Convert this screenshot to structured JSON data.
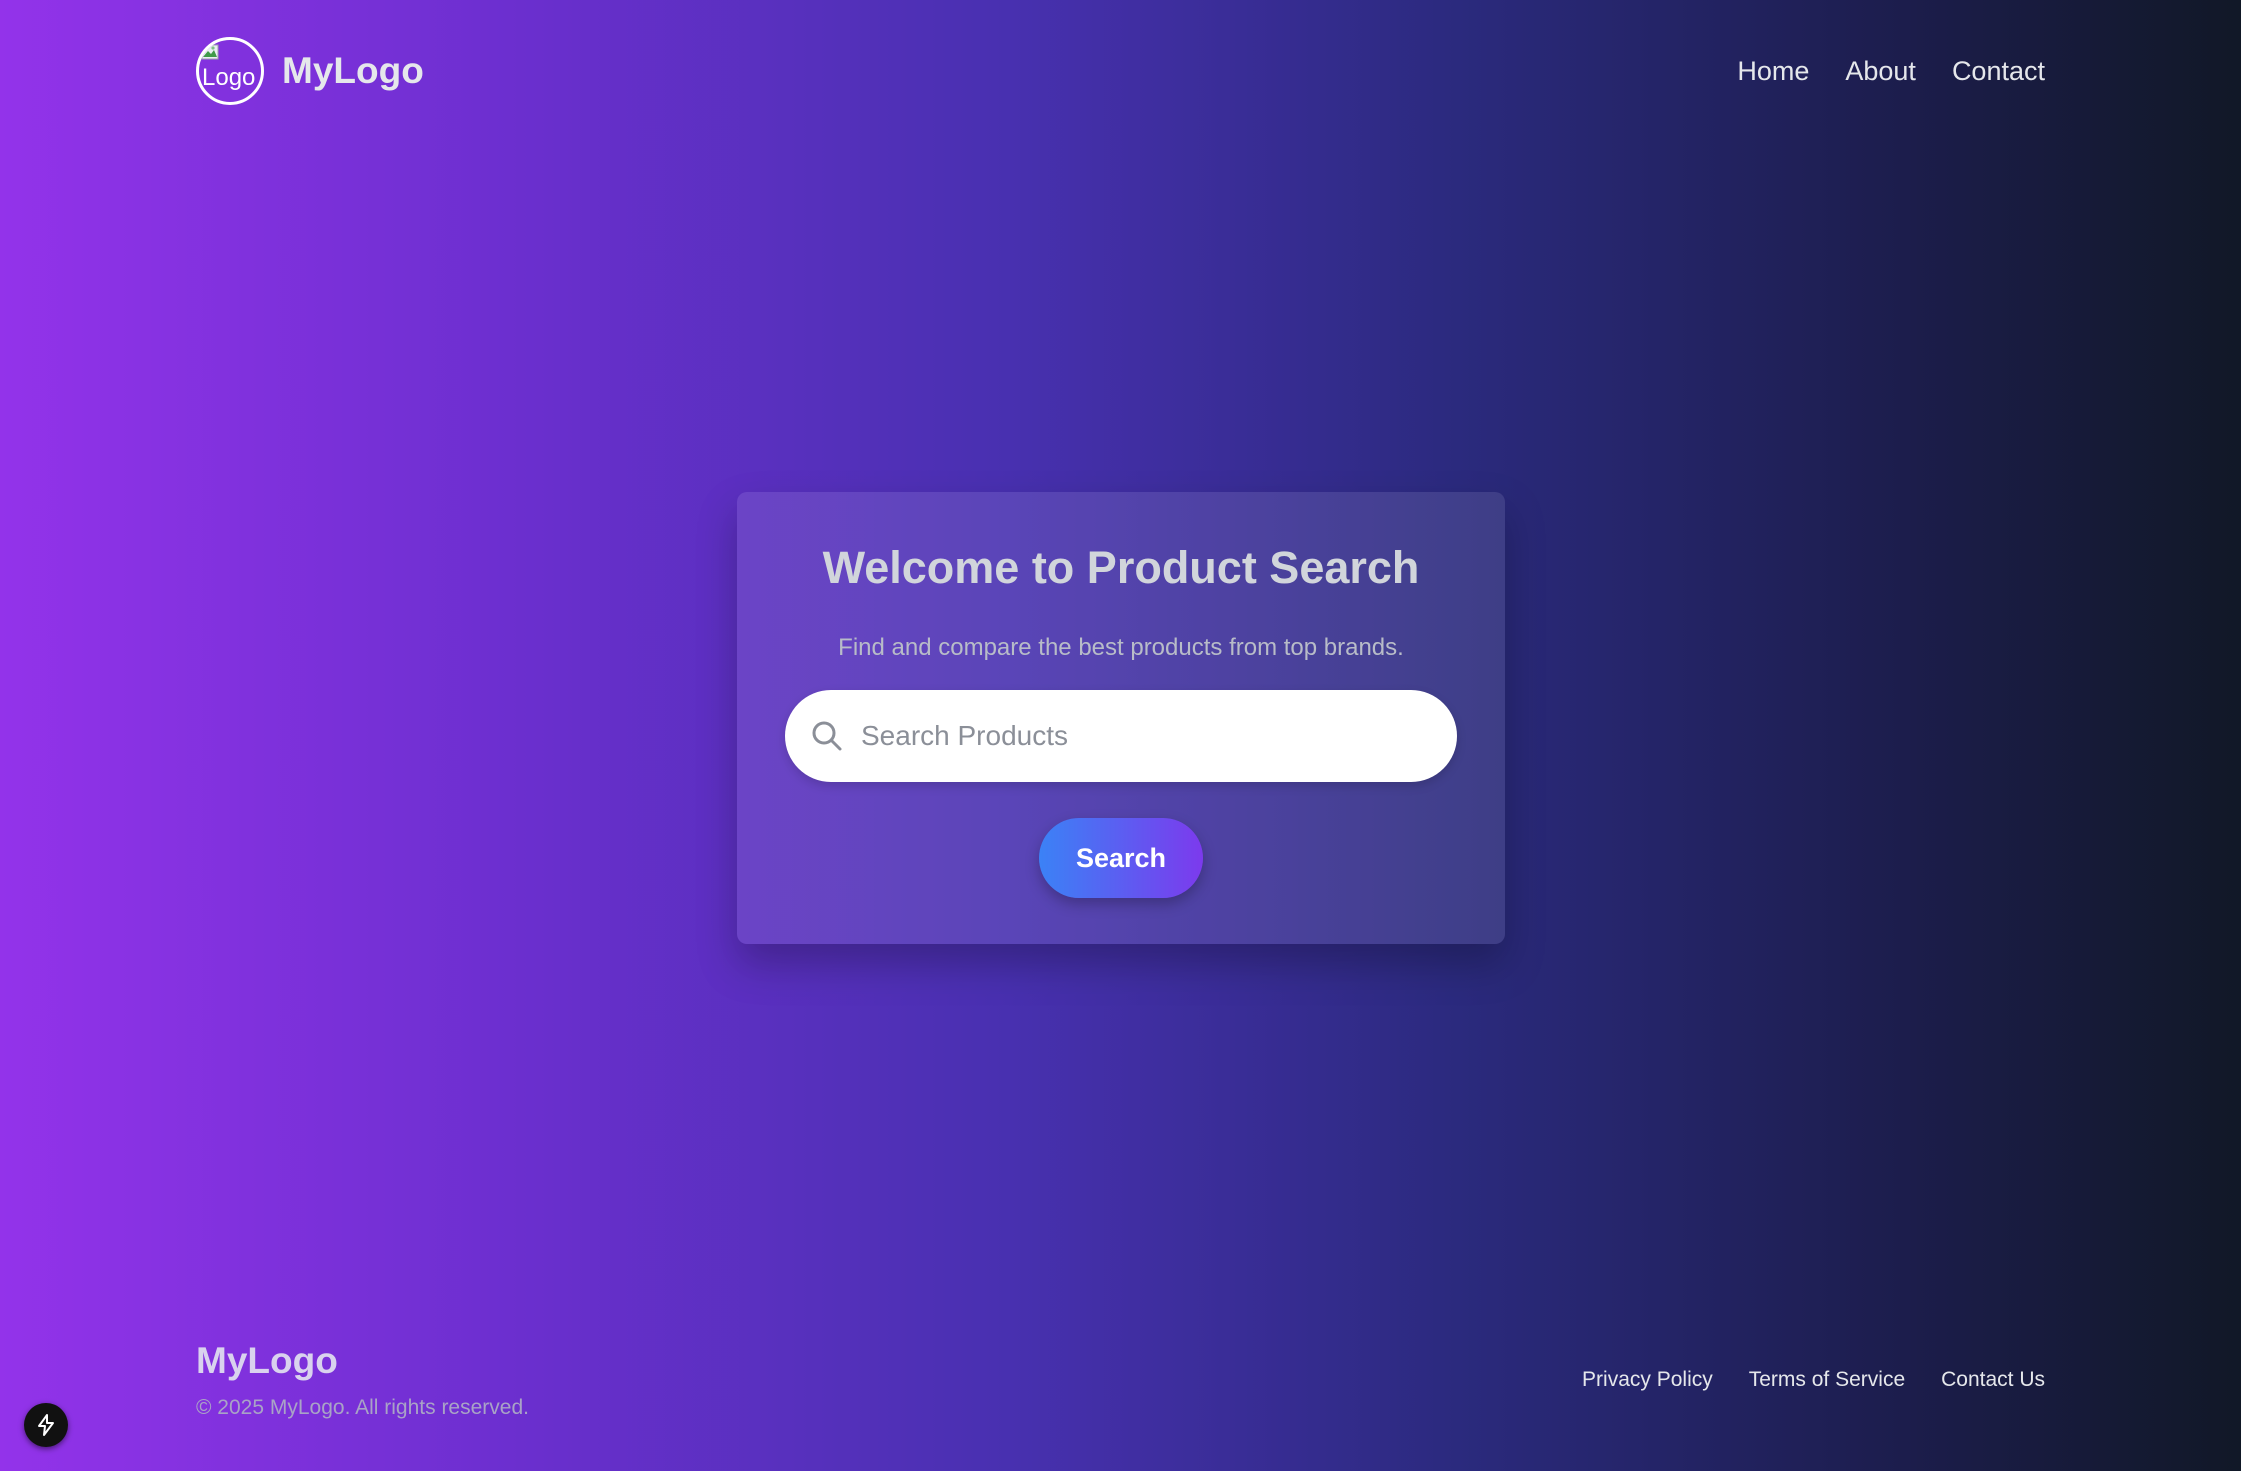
{
  "header": {
    "logo_alt": "Logo",
    "brand": "MyLogo",
    "nav": [
      {
        "label": "Home"
      },
      {
        "label": "About"
      },
      {
        "label": "Contact"
      }
    ]
  },
  "hero": {
    "title": "Welcome to Product Search",
    "subtitle": "Find and compare the best products from top brands.",
    "search": {
      "placeholder": "Search Products",
      "value": "",
      "icon": "search-icon"
    },
    "button_label": "Search"
  },
  "footer": {
    "brand": "MyLogo",
    "copyright": "© 2025 MyLogo. All rights reserved.",
    "links": [
      {
        "label": "Privacy Policy"
      },
      {
        "label": "Terms of Service"
      },
      {
        "label": "Contact Us"
      }
    ]
  },
  "badge": {
    "icon": "lightning-icon"
  },
  "colors": {
    "gradient_start": "#9333ea",
    "gradient_end": "#111827",
    "button_start": "#3b82f6",
    "button_end": "#7c3aed"
  }
}
